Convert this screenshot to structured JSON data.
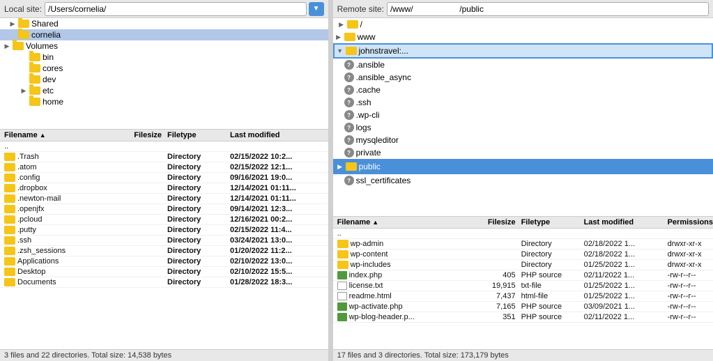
{
  "left_panel": {
    "site_label": "Local site:",
    "site_path": "/Users/cornelia/",
    "tree_items": [
      {
        "indent": 1,
        "label": "Shared",
        "type": "folder",
        "expandable": true
      },
      {
        "indent": 1,
        "label": "cornelia",
        "type": "folder",
        "selected": true
      },
      {
        "indent": 0,
        "label": "Volumes",
        "type": "folder",
        "expandable": true
      },
      {
        "indent": 1,
        "label": "bin",
        "type": "folder"
      },
      {
        "indent": 1,
        "label": "cores",
        "type": "folder"
      },
      {
        "indent": 1,
        "label": "dev",
        "type": "folder"
      },
      {
        "indent": 1,
        "label": "etc",
        "type": "folder"
      },
      {
        "indent": 1,
        "label": "home",
        "type": "folder"
      }
    ],
    "columns": {
      "filename": "Filename",
      "filesize": "Filesize",
      "filetype": "Filetype",
      "lastmod": "Last modified"
    },
    "files": [
      {
        "name": "..",
        "size": "",
        "type": "",
        "modified": ""
      },
      {
        "name": ".Trash",
        "size": "",
        "type": "Directory",
        "modified": "02/15/2022 10:2..."
      },
      {
        "name": ".atom",
        "size": "",
        "type": "Directory",
        "modified": "02/15/2022 12:1..."
      },
      {
        "name": ".config",
        "size": "",
        "type": "Directory",
        "modified": "09/16/2021 19:0..."
      },
      {
        "name": ".dropbox",
        "size": "",
        "type": "Directory",
        "modified": "12/14/2021 01:11..."
      },
      {
        "name": ".newton-mail",
        "size": "",
        "type": "Directory",
        "modified": "12/14/2021 01:11..."
      },
      {
        "name": ".openjfx",
        "size": "",
        "type": "Directory",
        "modified": "09/14/2021 12:3..."
      },
      {
        "name": ".pcloud",
        "size": "",
        "type": "Directory",
        "modified": "12/16/2021 00:2..."
      },
      {
        "name": ".putty",
        "size": "",
        "type": "Directory",
        "modified": "02/15/2022 11:4..."
      },
      {
        "name": ".ssh",
        "size": "",
        "type": "Directory",
        "modified": "03/24/2021 13:0..."
      },
      {
        "name": ".zsh_sessions",
        "size": "",
        "type": "Directory",
        "modified": "01/20/2022 11:2..."
      },
      {
        "name": "Applications",
        "size": "",
        "type": "Directory",
        "modified": "02/10/2022 13:0..."
      },
      {
        "name": "Desktop",
        "size": "",
        "type": "Directory",
        "modified": "02/10/2022 15:5..."
      },
      {
        "name": "Documents",
        "size": "",
        "type": "Directory",
        "modified": "01/28/2022 18:3..."
      }
    ],
    "status": "3 files and 22 directories. Total size: 14,538 bytes"
  },
  "right_panel": {
    "site_label": "Remote site:",
    "site_path": "/www/                    /public",
    "tree_items": [
      {
        "indent": 0,
        "label": "/",
        "type": "folder",
        "expandable": true
      },
      {
        "indent": 1,
        "label": "www",
        "type": "folder",
        "expandable": true
      },
      {
        "indent": 2,
        "label": "johnstravel:...",
        "type": "folder",
        "expandable": true,
        "highlighted": true
      },
      {
        "indent": 3,
        "label": ".ansible",
        "type": "question"
      },
      {
        "indent": 3,
        "label": ".ansible_async",
        "type": "question"
      },
      {
        "indent": 3,
        "label": ".cache",
        "type": "question"
      },
      {
        "indent": 3,
        "label": ".ssh",
        "type": "question"
      },
      {
        "indent": 3,
        "label": ".wp-cli",
        "type": "question"
      },
      {
        "indent": 3,
        "label": "logs",
        "type": "question"
      },
      {
        "indent": 3,
        "label": "mysqleditor",
        "type": "question"
      },
      {
        "indent": 3,
        "label": "private",
        "type": "question"
      },
      {
        "indent": 3,
        "label": "public",
        "type": "folder",
        "selected": true,
        "expandable": true
      },
      {
        "indent": 3,
        "label": "ssl_certificates",
        "type": "question"
      }
    ],
    "columns": {
      "filename": "Filename",
      "filesize": "Filesize",
      "filetype": "Filetype",
      "lastmod": "Last modified",
      "permissions": "Permissions"
    },
    "files": [
      {
        "name": "..",
        "size": "",
        "type": "",
        "modified": "",
        "perms": ""
      },
      {
        "name": "wp-admin",
        "size": "",
        "type": "Directory",
        "modified": "02/18/2022 1...",
        "perms": "drwxr-xr-x"
      },
      {
        "name": "wp-content",
        "size": "",
        "type": "Directory",
        "modified": "02/18/2022 1...",
        "perms": "drwxr-xr-x"
      },
      {
        "name": "wp-includes",
        "size": "",
        "type": "Directory",
        "modified": "01/25/2022 1...",
        "perms": "drwxr-xr-x"
      },
      {
        "name": "index.php",
        "size": "405",
        "type": "PHP source",
        "modified": "02/11/2022 1...",
        "perms": "-rw-r--r--"
      },
      {
        "name": "license.txt",
        "size": "19,915",
        "type": "txt-file",
        "modified": "01/25/2022 1...",
        "perms": "-rw-r--r--"
      },
      {
        "name": "readme.html",
        "size": "7,437",
        "type": "html-file",
        "modified": "01/25/2022 1...",
        "perms": "-rw-r--r--"
      },
      {
        "name": "wp-activate.php",
        "size": "7,165",
        "type": "PHP source",
        "modified": "03/09/2021 1...",
        "perms": "-rw-r--r--"
      },
      {
        "name": "wp-blog-header.p...",
        "size": "351",
        "type": "PHP source",
        "modified": "02/11/2022 1...",
        "perms": "-rw-r--r--"
      }
    ],
    "status": "17 files and 3 directories. Total size: 173,179 bytes"
  }
}
